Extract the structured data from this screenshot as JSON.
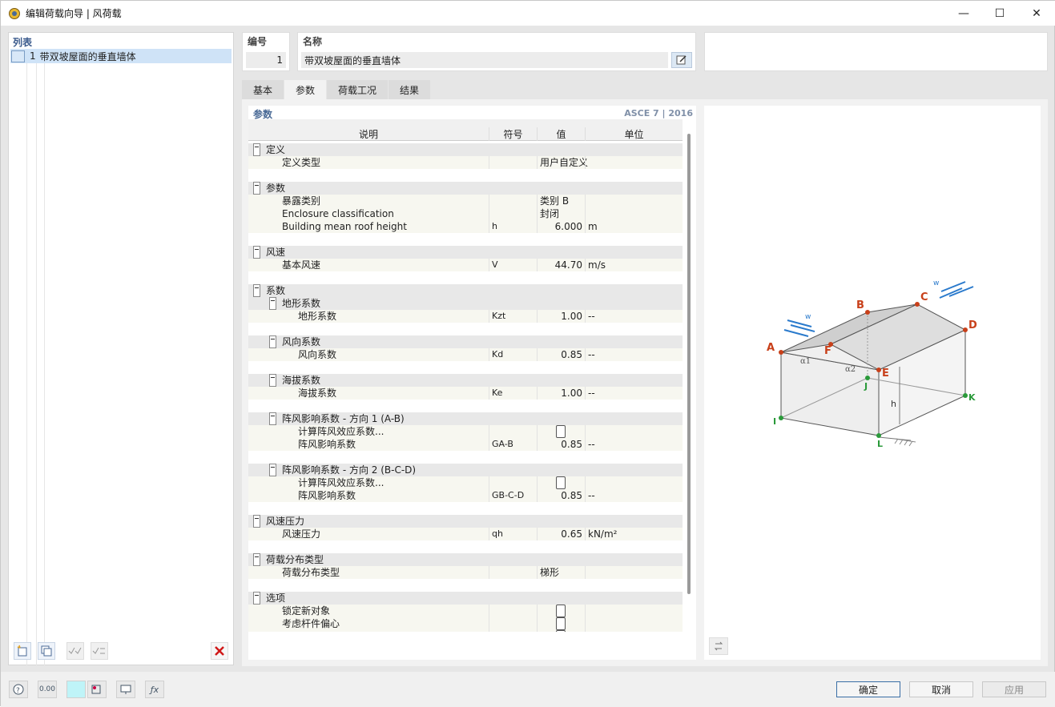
{
  "window": {
    "title": "编辑荷载向导 | 风荷载",
    "minimize": "—",
    "maximize": "☐",
    "close": "✕"
  },
  "list": {
    "header": "列表",
    "items": [
      {
        "number": "1",
        "label": "带双坡屋面的垂直墙体"
      }
    ]
  },
  "header": {
    "number_label": "编号",
    "number_value": "1",
    "name_label": "名称",
    "name_value": "带双坡屋面的垂直墙体"
  },
  "tabs": [
    {
      "label": "基本",
      "active": false
    },
    {
      "label": "参数",
      "active": true
    },
    {
      "label": "荷载工况",
      "active": false
    },
    {
      "label": "结果",
      "active": false
    }
  ],
  "params": {
    "title": "参数",
    "standard": "ASCE 7 | 2016",
    "columns": {
      "desc": "说明",
      "symbol": "符号",
      "value": "值",
      "unit": "单位"
    },
    "rows": [
      {
        "level": 0,
        "kind": "group",
        "desc": "定义"
      },
      {
        "level": 1,
        "desc": "定义类型",
        "symbol": "",
        "value": "用户自定义",
        "unit": "",
        "align": "left"
      },
      {
        "kind": "blank"
      },
      {
        "level": 0,
        "kind": "group",
        "desc": "参数"
      },
      {
        "level": 1,
        "desc": "暴露类别",
        "symbol": "",
        "value": "类别 B",
        "unit": "",
        "align": "left"
      },
      {
        "level": 1,
        "desc": "Enclosure classification",
        "symbol": "",
        "value": "封闭",
        "unit": "",
        "align": "left"
      },
      {
        "level": 1,
        "desc": "Building mean roof height",
        "symbol": "h",
        "value": "6.000",
        "unit": "m"
      },
      {
        "kind": "blank"
      },
      {
        "level": 0,
        "kind": "group",
        "desc": "风速"
      },
      {
        "level": 1,
        "desc": "基本风速",
        "symbol": "V",
        "value": "44.70",
        "unit": "m/s"
      },
      {
        "kind": "blank"
      },
      {
        "level": 0,
        "kind": "group",
        "desc": "系数"
      },
      {
        "level": 1,
        "kind": "group",
        "desc": "地形系数"
      },
      {
        "level": 2,
        "desc": "地形系数",
        "symbol": "Kzt",
        "value": "1.00",
        "unit": "--"
      },
      {
        "kind": "blank"
      },
      {
        "level": 1,
        "kind": "group",
        "desc": "风向系数"
      },
      {
        "level": 2,
        "desc": "风向系数",
        "symbol": "Kd",
        "value": "0.85",
        "unit": "--"
      },
      {
        "kind": "blank"
      },
      {
        "level": 1,
        "kind": "group",
        "desc": "海拔系数"
      },
      {
        "level": 2,
        "desc": "海拔系数",
        "symbol": "Ke",
        "value": "1.00",
        "unit": "--"
      },
      {
        "kind": "blank"
      },
      {
        "level": 1,
        "kind": "group",
        "desc": "阵风影响系数 - 方向 1 (A-B)"
      },
      {
        "level": 2,
        "desc": "计算阵风效应系数...",
        "checkbox": true
      },
      {
        "level": 2,
        "desc": "阵风影响系数",
        "symbol": "GA-B",
        "value": "0.85",
        "unit": "--"
      },
      {
        "kind": "blank"
      },
      {
        "level": 1,
        "kind": "group",
        "desc": "阵风影响系数 - 方向 2 (B-C-D)"
      },
      {
        "level": 2,
        "desc": "计算阵风效应系数...",
        "checkbox": true
      },
      {
        "level": 2,
        "desc": "阵风影响系数",
        "symbol": "GB-C-D",
        "value": "0.85",
        "unit": "--"
      },
      {
        "kind": "blank"
      },
      {
        "level": 0,
        "kind": "group",
        "desc": "风速压力"
      },
      {
        "level": 1,
        "desc": "风速压力",
        "symbol": "qh",
        "value": "0.65",
        "unit": "kN/m²"
      },
      {
        "kind": "blank"
      },
      {
        "level": 0,
        "kind": "group",
        "desc": "荷载分布类型"
      },
      {
        "level": 1,
        "desc": "荷载分布类型",
        "symbol": "",
        "value": "梯形",
        "unit": "",
        "align": "left"
      },
      {
        "kind": "blank"
      },
      {
        "level": 0,
        "kind": "group",
        "desc": "选项"
      },
      {
        "level": 1,
        "desc": "锁定新对象",
        "checkbox": true
      },
      {
        "level": 1,
        "desc": "考虑杆件偏心",
        "checkbox": true
      },
      {
        "level": 1,
        "desc": "",
        "checkbox": true
      }
    ]
  },
  "diagram": {
    "points": [
      "A",
      "B",
      "C",
      "D",
      "E",
      "F",
      "I",
      "J",
      "K",
      "L"
    ],
    "labels": {
      "w": "w",
      "h": "h",
      "alpha1": "α1",
      "alpha2": "α2"
    },
    "colors": {
      "red_point": "#c8401a",
      "green_point": "#2a9a3a",
      "wind": "#2a7acc"
    }
  },
  "buttons": {
    "ok": "确定",
    "cancel": "取消",
    "apply": "应用"
  },
  "bottom_icons": [
    "help-icon",
    "units-icon",
    "color-icon",
    "view-icon",
    "display-icon",
    "function-icon"
  ],
  "bottom_units_text": "0.00"
}
